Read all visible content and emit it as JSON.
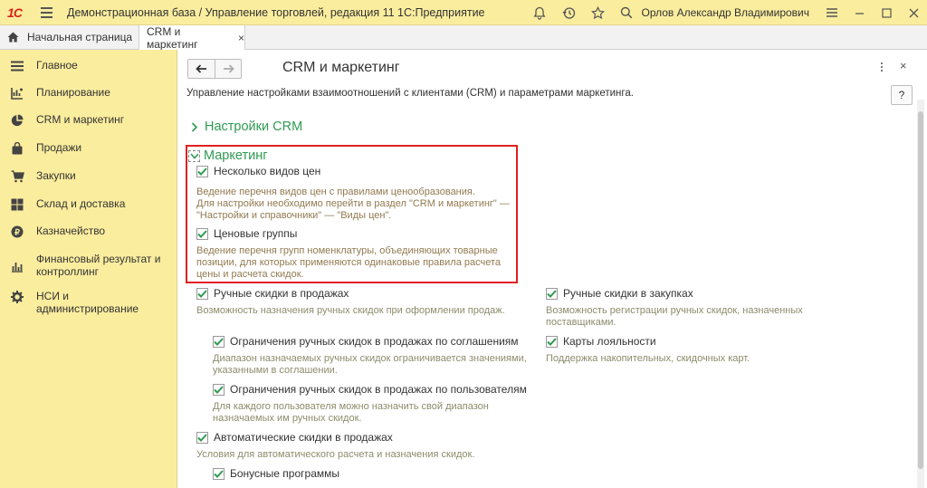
{
  "titlebar": {
    "logo": "1С",
    "title": "Демонстрационная база / Управление торговлей, редакция 11 1С:Предприятие",
    "user": "Орлов Александр Владимирович"
  },
  "tabs": {
    "home": "Начальная страница",
    "active": "CRM и маркетинг",
    "active_close": "×"
  },
  "sidebar": {
    "items": [
      {
        "label": "Главное",
        "icon": "menu-lines-icon"
      },
      {
        "label": "Планирование",
        "icon": "planning-icon"
      },
      {
        "label": "CRM и маркетинг",
        "icon": "pie-chart-icon"
      },
      {
        "label": "Продажи",
        "icon": "bag-icon"
      },
      {
        "label": "Закупки",
        "icon": "cart-icon"
      },
      {
        "label": "Склад и доставка",
        "icon": "warehouse-icon"
      },
      {
        "label": "Казначейство",
        "icon": "coin-icon"
      },
      {
        "label": "Финансовый результат и контроллинг",
        "icon": "bar-chart-icon"
      },
      {
        "label": "НСИ и администрирование",
        "icon": "gear-icon"
      }
    ]
  },
  "main": {
    "title": "CRM и маркетинг",
    "description": "Управление настройками взаимоотношений с клиентами (CRM) и параметрами маркетинга.",
    "help": "?",
    "close": "×",
    "crm_section": "Настройки CRM",
    "marketing_section": "Маркетинг",
    "options": {
      "price_types": {
        "label": "Несколько видов цен",
        "checked": true,
        "hint1": "Ведение перечня видов цен с правилами ценообразования.",
        "hint2": "Для настройки необходимо перейти в раздел \"CRM и маркетинг\" —",
        "hint3": "\"Настройки и справочники\" — \"Виды цен\"."
      },
      "price_groups": {
        "label": "Ценовые группы",
        "checked": true,
        "hint1": "Ведение перечня групп номенклатуры, объединяющих товарные",
        "hint2": "позиции, для которых применяются одинаковые правила расчета",
        "hint3": "цены и расчета скидок."
      },
      "manual_sales": {
        "label": "Ручные скидки в продажах",
        "checked": true,
        "hint1": "Возможность назначения ручных скидок при оформлении продаж."
      },
      "manual_purchases": {
        "label": "Ручные скидки в закупках",
        "checked": true,
        "hint1": "Возможность регистрации ручных скидок, назначенных",
        "hint2": "поставщиками."
      },
      "limit_agreements": {
        "label": "Ограничения ручных скидок в продажах по соглашениям",
        "checked": true,
        "hint1": "Диапазон назначаемых ручных скидок ограничивается значениями,",
        "hint2": "указанными в соглашении."
      },
      "loyalty_cards": {
        "label": "Карты лояльности",
        "checked": true,
        "hint1": "Поддержка накопительных, скидочных карт."
      },
      "limit_users": {
        "label": "Ограничения ручных скидок в продажах по пользователям",
        "checked": true,
        "hint1": "Для каждого пользователя можно назначить свой диапазон",
        "hint2": "назначаемых им ручных скидок."
      },
      "auto_sales": {
        "label": "Автоматические скидки в продажах",
        "checked": true,
        "hint1": "Условия для автоматического расчета и назначения скидок."
      },
      "bonus": {
        "label": "Бонусные программы",
        "checked": true
      }
    }
  },
  "colors": {
    "accent_green": "#2f9a52",
    "panel_yellow": "#fbed9e",
    "highlight_red": "#e02020"
  }
}
